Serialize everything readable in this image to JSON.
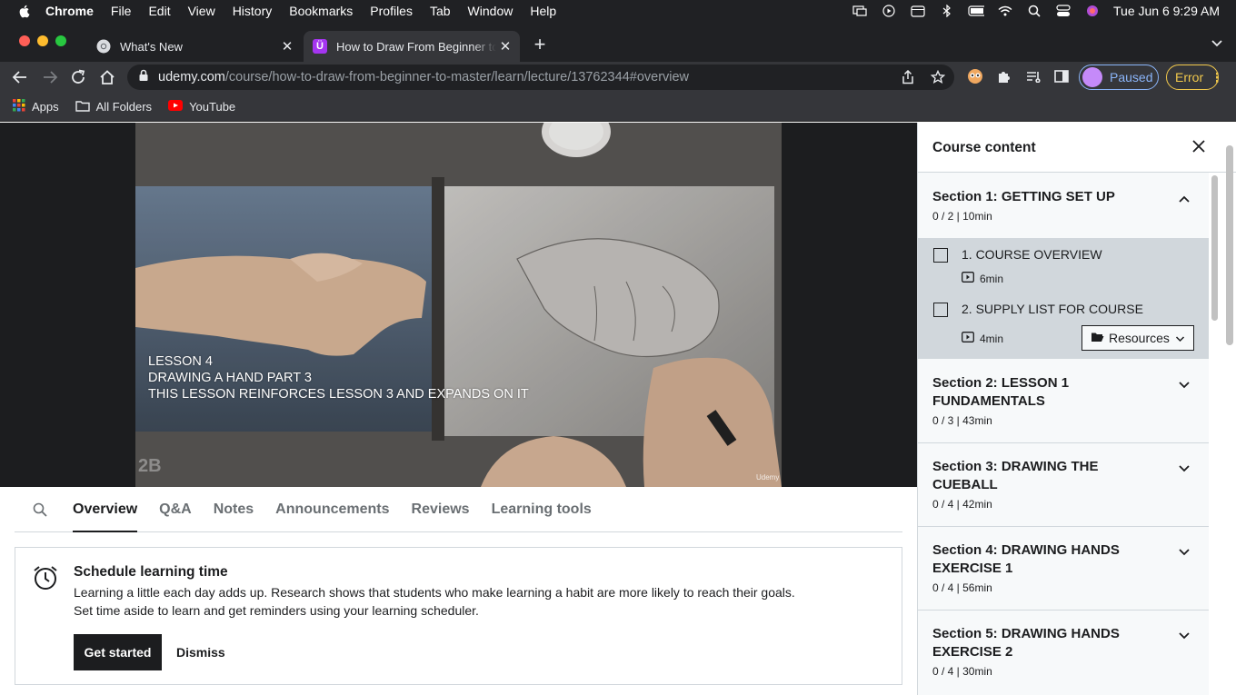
{
  "menubar": {
    "app": "Chrome",
    "items": [
      "File",
      "Edit",
      "View",
      "History",
      "Bookmarks",
      "Profiles",
      "Tab",
      "Window",
      "Help"
    ],
    "clock": "Tue Jun 6  9:29 AM"
  },
  "tabs": [
    {
      "title": "What's New",
      "active": false
    },
    {
      "title": "How to Draw From Beginner to",
      "active": true
    }
  ],
  "omnibox": {
    "host": "udemy.com",
    "path": "/course/how-to-draw-from-beginner-to-master/learn/lecture/13762344#overview"
  },
  "profile": {
    "label": "Paused"
  },
  "error_button": {
    "label": "Error"
  },
  "bookmarks": [
    {
      "label": "Apps",
      "icon": "apps-grid-icon"
    },
    {
      "label": "All Folders",
      "icon": "folder-icon"
    },
    {
      "label": "YouTube",
      "icon": "youtube-icon"
    }
  ],
  "video": {
    "caption": [
      "LESSON 4",
      "DRAWING A HAND PART 3",
      "THIS LESSON REINFORCES LESSON 3 AND EXPANDS ON IT"
    ],
    "watermark_left": "2B",
    "watermark_right": "Udemy"
  },
  "page_tabs": [
    "Overview",
    "Q&A",
    "Notes",
    "Announcements",
    "Reviews",
    "Learning tools"
  ],
  "active_page_tab": "Overview",
  "schedule": {
    "title": "Schedule learning time",
    "line1": "Learning a little each day adds up. Research shows that students who make learning a habit are more likely to reach their goals.",
    "line2": "Set time aside to learn and get reminders using your learning scheduler.",
    "primary": "Get started",
    "secondary": "Dismiss"
  },
  "sidebar": {
    "title": "Course content",
    "sections": [
      {
        "title": "Section 1: GETTING SET UP",
        "meta": "0 / 2 | 10min",
        "expanded": true
      },
      {
        "title": "Section 2: LESSON 1 FUNDAMENTALS",
        "meta": "0 / 3 | 43min",
        "expanded": false
      },
      {
        "title": "Section 3: DRAWING THE CUEBALL",
        "meta": "0 / 4 | 42min",
        "expanded": false
      },
      {
        "title": "Section 4: DRAWING HANDS EXERCISE 1",
        "meta": "0 / 4 | 56min",
        "expanded": false
      },
      {
        "title": "Section 5: DRAWING HANDS EXERCISE 2",
        "meta": "0 / 4 | 30min",
        "expanded": false
      }
    ],
    "lectures": [
      {
        "title": "1. COURSE OVERVIEW",
        "duration": "6min"
      },
      {
        "title": "2. SUPPLY LIST FOR COURSE",
        "duration": "4min",
        "resources": "Resources"
      }
    ]
  },
  "colors": {
    "chrome_dark": "#202124",
    "chrome_toolbar": "#35363a",
    "udemy_text": "#1c1d1f",
    "border": "#d1d7dc",
    "section_bg": "#f7f9fa",
    "paused_blue": "#8ab4f8",
    "error_yellow": "#f2c94c",
    "udemy_purple": "#a435f0"
  }
}
